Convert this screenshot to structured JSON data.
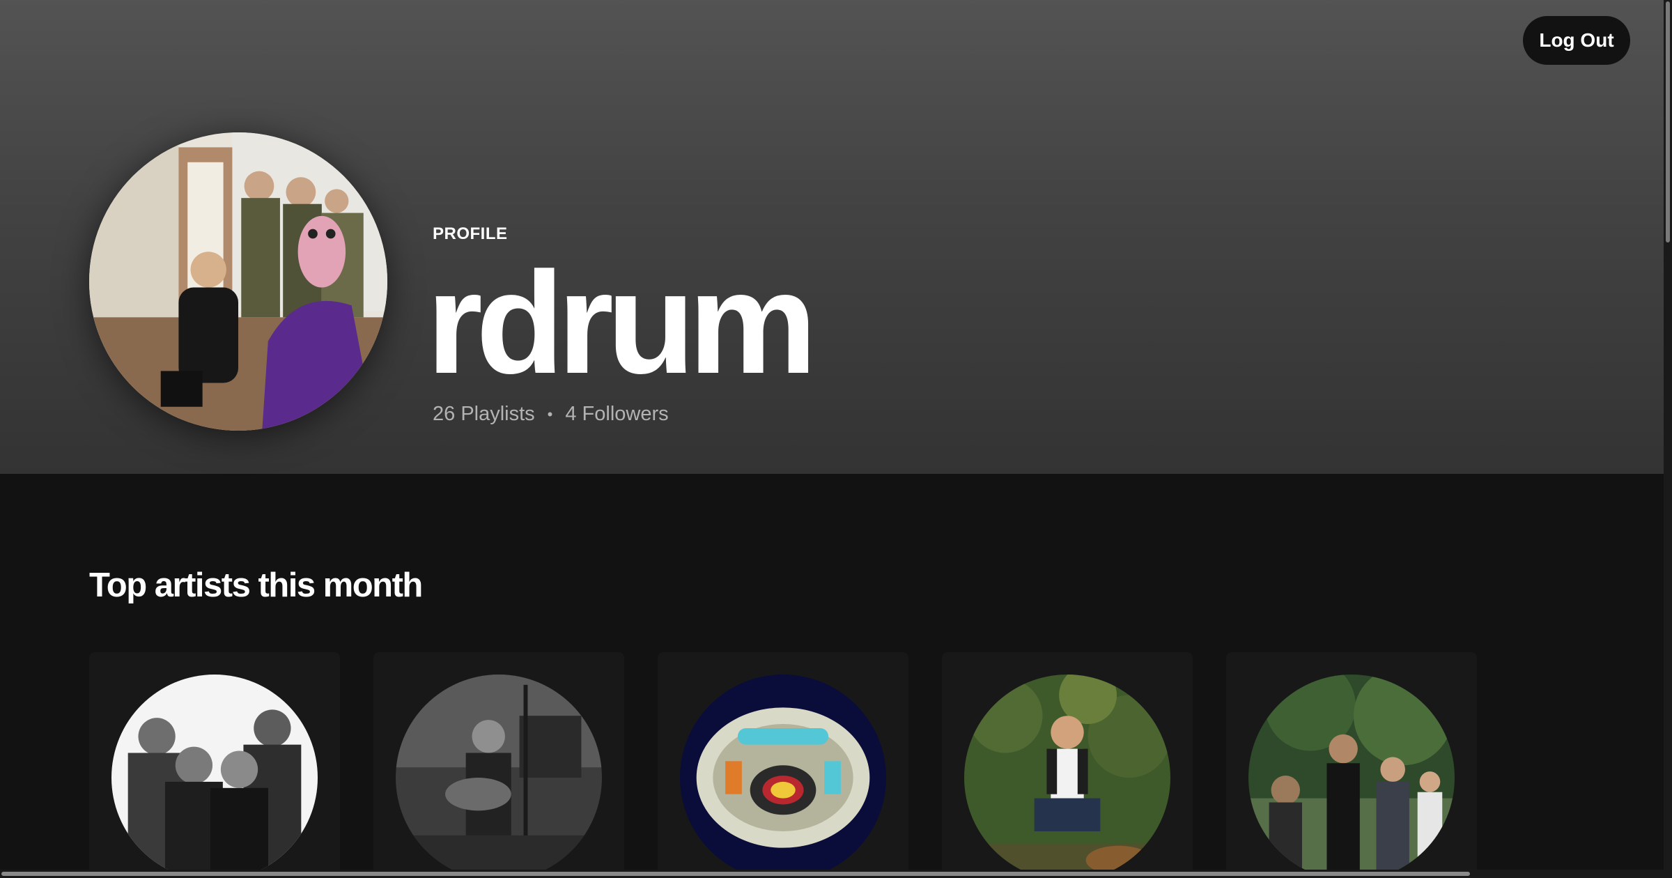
{
  "header": {
    "logout_label": "Log Out",
    "profile_label": "PROFILE",
    "username": "rdrum",
    "playlists": "26 Playlists",
    "separator": "•",
    "followers": "4 Followers"
  },
  "top_artists": {
    "title": "Top artists this month",
    "cards": [
      {
        "art": "band-photo-bw"
      },
      {
        "art": "guitarist-studio-bw"
      },
      {
        "art": "elo-spaceship-album"
      },
      {
        "art": "musician-garden-photo"
      },
      {
        "art": "band-in-park-photo"
      }
    ]
  },
  "colors": {
    "background": "#121212",
    "header_top": "#535353",
    "header_bottom": "#333333",
    "card": "#181818",
    "muted_text": "#b3b3b3"
  }
}
